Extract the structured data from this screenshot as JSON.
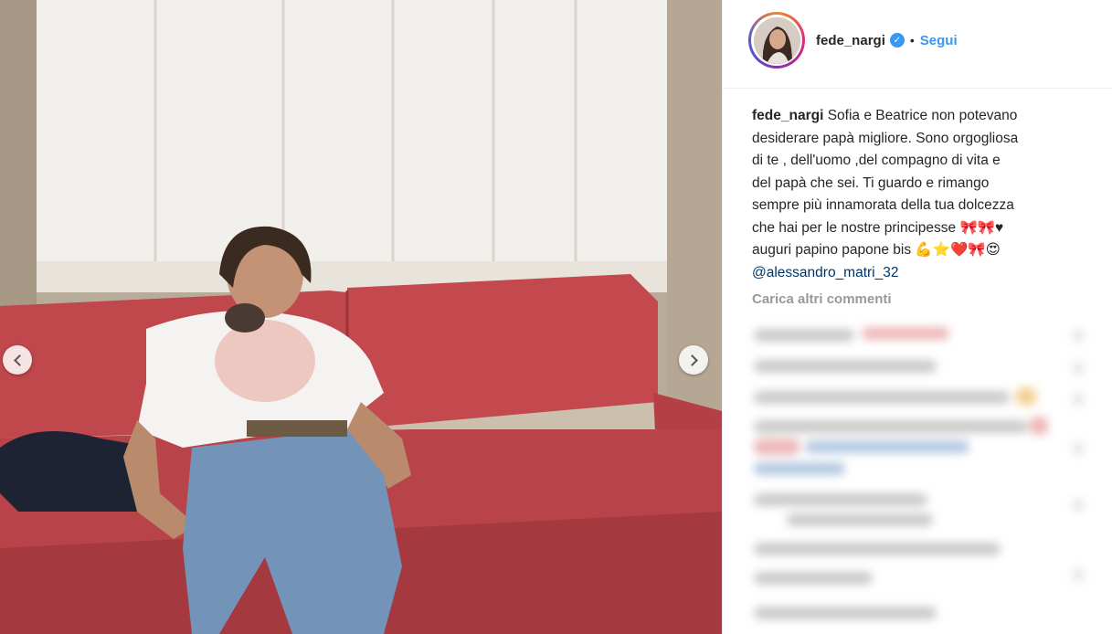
{
  "post": {
    "username": "fede_nargi",
    "verified_icon": "verified-badge-icon",
    "separator": "•",
    "follow_label": "Segui",
    "caption_user": "fede_nargi",
    "caption_lines": [
      "Sofia e Beatrice non potevano",
      "desiderare papà migliore. Sono orgogliosa",
      "di te , dell'uomo ,del compagno di vita e",
      "del papà che sei. Ti guardo e rimango",
      "sempre più innamorata della tua dolcezza",
      "che hai per le nostre principesse 🎀🎀♥",
      "auguri papino papone bis 💪⭐❤️🎀😍"
    ],
    "mention": "@alessandro_matri_32",
    "load_more_label": "Carica altri commenti"
  },
  "carousel": {
    "prev_icon": "chevron-left-icon",
    "next_icon": "chevron-right-icon"
  },
  "colors": {
    "accent": "#3897f0",
    "sofa": "#c0474c",
    "curtain": "#f2f0ec"
  }
}
